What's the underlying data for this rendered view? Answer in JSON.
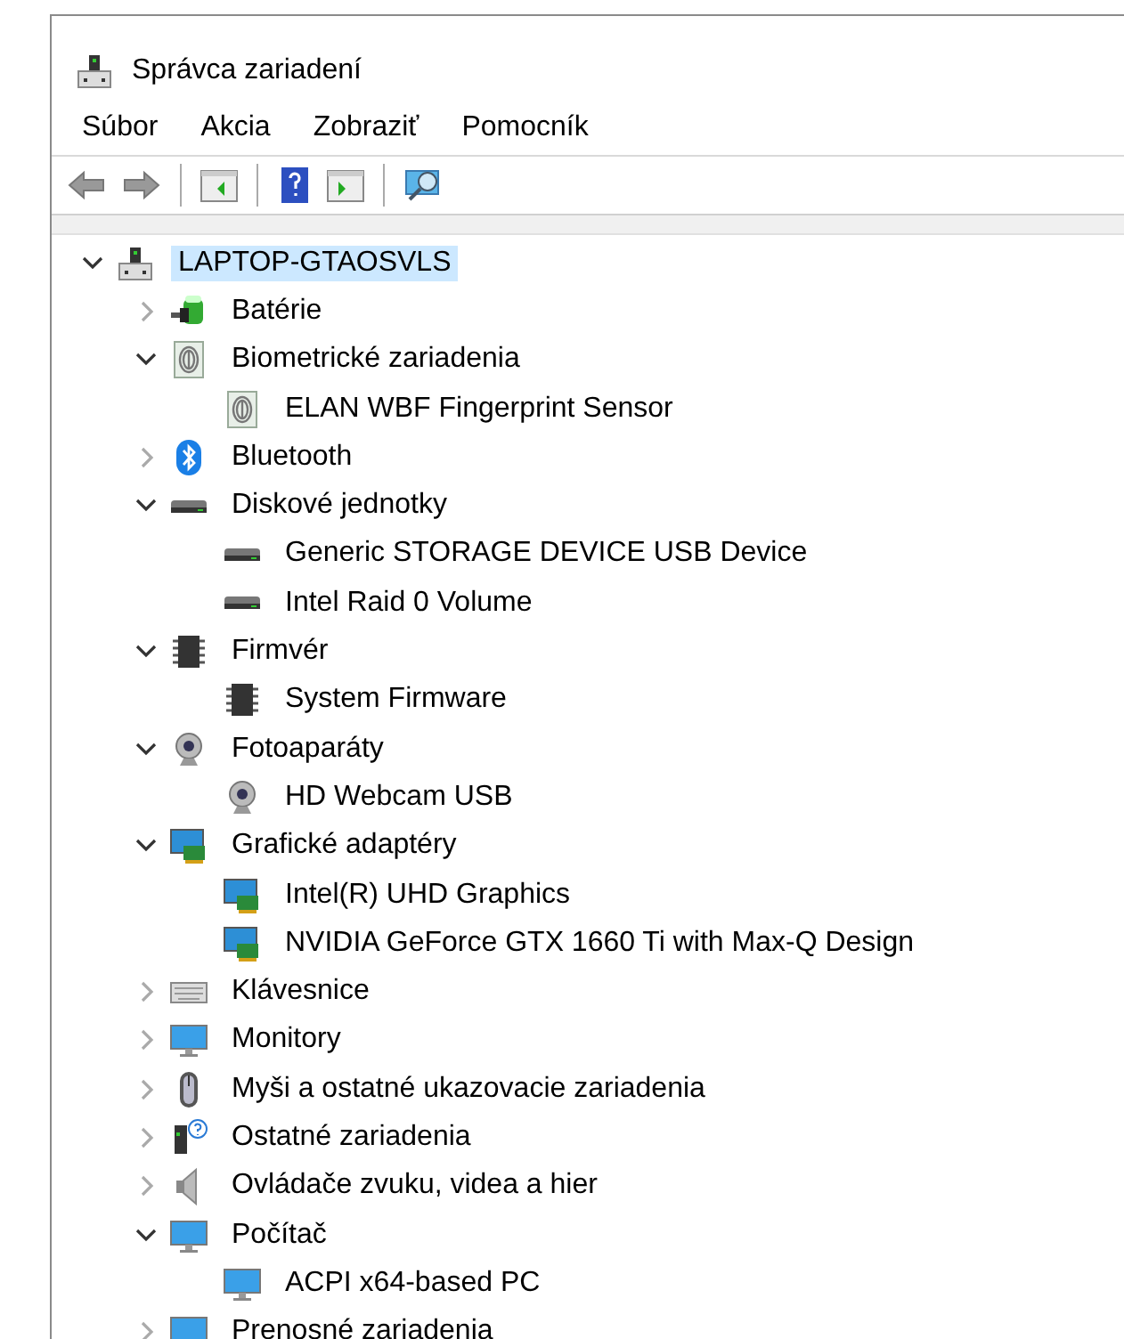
{
  "window": {
    "title": "Správca zariadení"
  },
  "menu": [
    {
      "label": "Súbor"
    },
    {
      "label": "Akcia"
    },
    {
      "label": "Zobraziť"
    },
    {
      "label": "Pomocník"
    }
  ],
  "toolbar": [
    {
      "kind": "back"
    },
    {
      "kind": "forward"
    },
    {
      "kind": "separator"
    },
    {
      "kind": "tree-panel"
    },
    {
      "kind": "separator"
    },
    {
      "kind": "help"
    },
    {
      "kind": "action-panel"
    },
    {
      "kind": "separator"
    },
    {
      "kind": "scan"
    }
  ],
  "tree": [
    {
      "label": "LAPTOP-GTAOSVLS",
      "kind": "computer",
      "selected": true,
      "expanded": true,
      "children": [
        {
          "label": "Batérie",
          "kind": "battery",
          "selected": false,
          "expanded": false
        },
        {
          "label": "Biometrické zariadenia",
          "kind": "fingerprint",
          "selected": false,
          "expanded": true,
          "children": [
            {
              "label": "ELAN WBF Fingerprint Sensor",
              "kind": "fingerprint",
              "selected": false
            }
          ]
        },
        {
          "label": "Bluetooth",
          "kind": "bluetooth",
          "selected": false,
          "expanded": false
        },
        {
          "label": "Diskové jednotky",
          "kind": "disk",
          "selected": false,
          "expanded": true,
          "children": [
            {
              "label": "Generic STORAGE DEVICE USB Device",
              "kind": "disk",
              "selected": false
            },
            {
              "label": "Intel Raid 0 Volume",
              "kind": "disk",
              "selected": false
            }
          ]
        },
        {
          "label": "Firmvér",
          "kind": "chip",
          "selected": false,
          "expanded": true,
          "children": [
            {
              "label": "System Firmware",
              "kind": "chip",
              "selected": false
            }
          ]
        },
        {
          "label": "Fotoaparáty",
          "kind": "webcam",
          "selected": false,
          "expanded": true,
          "children": [
            {
              "label": "HD Webcam USB",
              "kind": "webcam",
              "selected": false
            }
          ]
        },
        {
          "label": "Grafické adaptéry",
          "kind": "display-adapter",
          "selected": false,
          "expanded": true,
          "children": [
            {
              "label": "Intel(R) UHD Graphics",
              "kind": "display-adapter",
              "selected": false
            },
            {
              "label": "NVIDIA GeForce GTX 1660 Ti with Max-Q Design",
              "kind": "display-adapter",
              "selected": false
            }
          ]
        },
        {
          "label": "Klávesnice",
          "kind": "keyboard",
          "selected": false,
          "expanded": false
        },
        {
          "label": "Monitory",
          "kind": "monitor",
          "selected": false,
          "expanded": false
        },
        {
          "label": "Myši a ostatné ukazovacie zariadenia",
          "kind": "mouse",
          "selected": false,
          "expanded": false
        },
        {
          "label": "Ostatné zariadenia",
          "kind": "unknown",
          "selected": false,
          "expanded": false
        },
        {
          "label": "Ovládače zvuku, videa a hier",
          "kind": "speaker",
          "selected": false,
          "expanded": false
        },
        {
          "label": "Počítač",
          "kind": "monitor",
          "selected": false,
          "expanded": true,
          "children": [
            {
              "label": "ACPI x64-based PC",
              "kind": "monitor",
              "selected": false
            }
          ]
        },
        {
          "label": "Prenosné zariadenia",
          "kind": "monitor",
          "selected": false,
          "expanded": false
        }
      ]
    }
  ]
}
